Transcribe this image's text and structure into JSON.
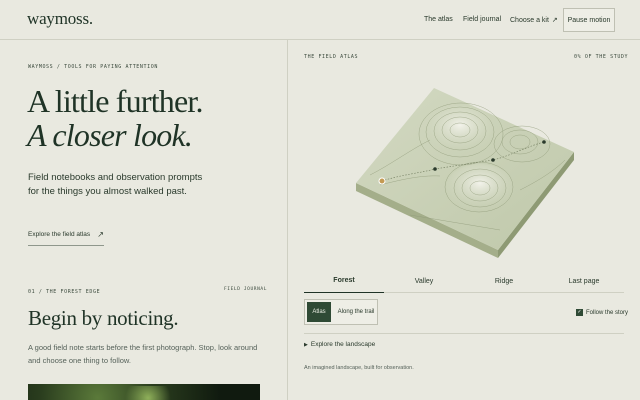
{
  "header": {
    "logo": "waymoss.",
    "nav": [
      {
        "label": "The atlas"
      },
      {
        "label": "Field journal"
      },
      {
        "label": "Choose a kit",
        "icon": "arrow-up-right-icon"
      }
    ],
    "pause_button": "Pause motion"
  },
  "hero": {
    "eyebrow": "WAYMOSS / TOOLS FOR PAYING ATTENTION",
    "headline_line1": "A little further.",
    "headline_line2": "A closer look.",
    "lede": "Field notebooks and observation prompts for the things you almost walked past.",
    "cta": "Explore the field atlas",
    "cta_icon": "arrow-up-right-icon"
  },
  "section": {
    "number": "01 / THE FOREST EDGE",
    "tag": "FIELD JOURNAL",
    "title": "Begin by noticing.",
    "body": "A good field note starts before the first photograph. Stop, look around and choose one thing to follow."
  },
  "atlas": {
    "label": "THE FIELD ATLAS",
    "progress": "0% OF THE STUDY",
    "tabs": [
      {
        "label": "Forest",
        "active": true
      },
      {
        "label": "Valley",
        "active": false
      },
      {
        "label": "Ridge",
        "active": false
      },
      {
        "label": "Last page",
        "active": false
      }
    ],
    "view_toggle": {
      "atlas": "Atlas",
      "trail": "Along the trail",
      "selected": "Atlas"
    },
    "follow_story": {
      "label": "Follow the story",
      "checked": true
    },
    "explore_landscape": "Explore the landscape",
    "footnote": "An imagined landscape, built for observation."
  },
  "colors": {
    "background": "#e9e9e0",
    "ink": "#1f3326",
    "accent": "#2f4a35",
    "terrain": "#c7cfb4"
  }
}
